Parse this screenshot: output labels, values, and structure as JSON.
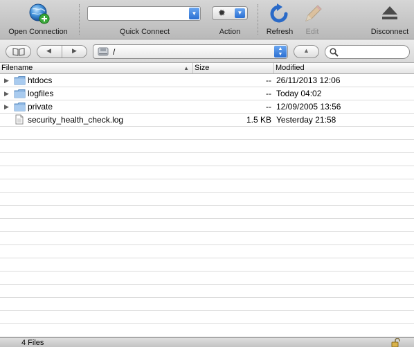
{
  "toolbar": {
    "open_connection": "Open Connection",
    "quick_connect": "Quick Connect",
    "quick_connect_value": "",
    "action": "Action",
    "refresh": "Refresh",
    "edit": "Edit",
    "disconnect": "Disconnect"
  },
  "navbar": {
    "path": "/",
    "search_value": ""
  },
  "columns": {
    "filename": "Filename",
    "size": "Size",
    "modified": "Modified"
  },
  "files": [
    {
      "name": "htdocs",
      "size": "--",
      "modified": "26/11/2013 12:06",
      "type": "folder"
    },
    {
      "name": "logfiles",
      "size": "--",
      "modified": "Today 04:02",
      "type": "folder"
    },
    {
      "name": "private",
      "size": "--",
      "modified": "12/09/2005 13:56",
      "type": "folder"
    },
    {
      "name": "security_health_check.log",
      "size": "1.5 KB",
      "modified": "Yesterday 21:58",
      "type": "file"
    }
  ],
  "status": {
    "text": "4 Files"
  },
  "icons": {
    "open_connection": "globe-plus-icon",
    "action": "gear-icon",
    "refresh": "refresh-icon",
    "edit": "pencil-icon",
    "disconnect": "eject-icon",
    "bookmarks": "book-icon",
    "back": "back-arrow-icon",
    "forward": "forward-arrow-icon",
    "up": "up-arrow-icon",
    "search": "search-icon",
    "folder": "folder-icon",
    "file": "document-icon",
    "lock": "lock-icon"
  }
}
